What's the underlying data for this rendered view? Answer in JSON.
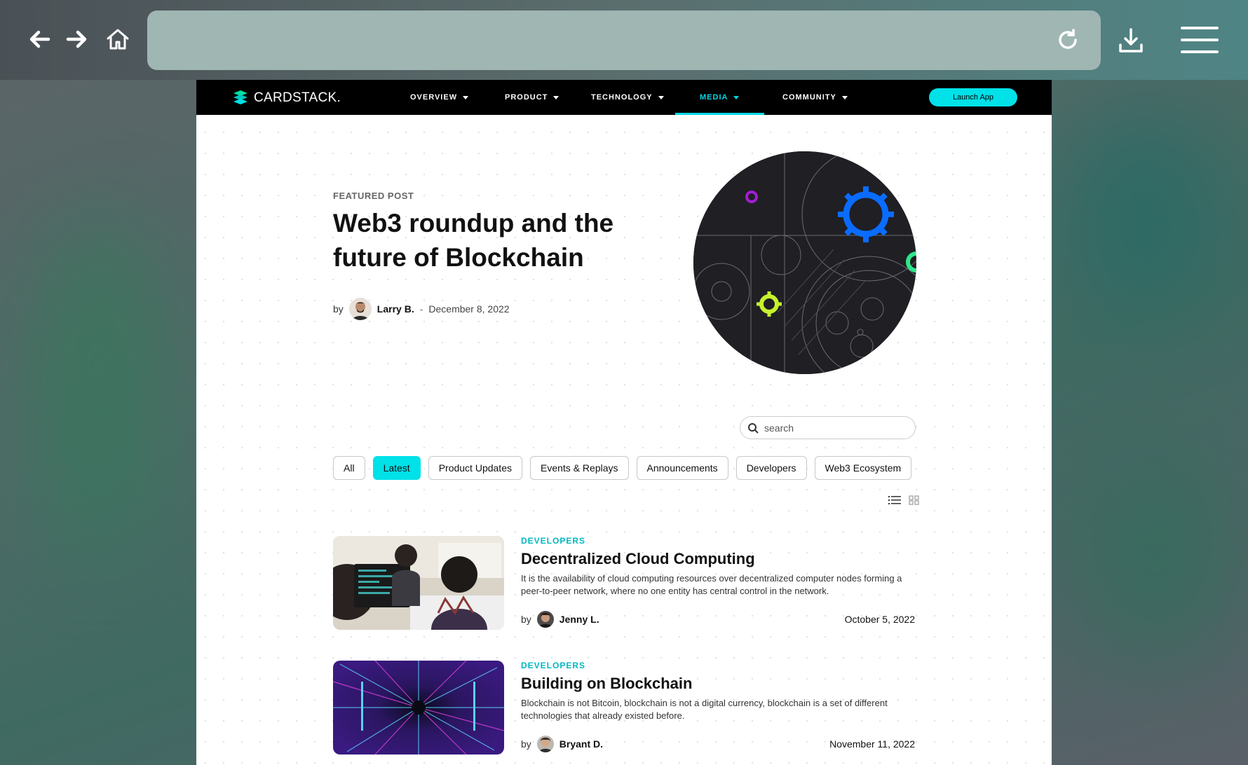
{
  "browser": {
    "address": "",
    "icons": [
      "back-arrow-icon",
      "forward-arrow-icon",
      "home-icon",
      "reload-icon",
      "download-icon",
      "hamburger-menu-icon"
    ]
  },
  "site": {
    "logo_text": "CARDSTACK.",
    "nav": [
      {
        "label": "OVERVIEW"
      },
      {
        "label": "PRODUCT"
      },
      {
        "label": "TECHNOLOGY"
      },
      {
        "label": "MEDIA"
      },
      {
        "label": "COMMUNITY"
      }
    ],
    "active_nav": "MEDIA",
    "launch_label": "Launch App",
    "accent_color": "#00e1e8"
  },
  "featured": {
    "label": "FEATURED POST",
    "title": "Web3 roundup and the future of Blockchain",
    "by": "by",
    "author": "Larry B.",
    "separator": "-",
    "date": "December 8, 2022"
  },
  "search": {
    "placeholder": "search"
  },
  "filters": [
    {
      "label": "All"
    },
    {
      "label": "Latest"
    },
    {
      "label": "Product Updates"
    },
    {
      "label": "Events & Replays"
    },
    {
      "label": "Announcements"
    },
    {
      "label": "Developers"
    },
    {
      "label": "Web3 Ecosystem"
    }
  ],
  "active_filter": "Latest",
  "posts": [
    {
      "category": "DEVELOPERS",
      "title": "Decentralized Cloud Computing",
      "description": "It is the availability of cloud computing resources over decentralized computer nodes forming a peer-to-peer network, where no one entity has central control in the network.",
      "by": "by",
      "author": "Jenny L.",
      "date": "October 5, 2022"
    },
    {
      "category": "DEVELOPERS",
      "title": "Building on Blockchain",
      "description": "Blockchain is not Bitcoin, blockchain is not a digital currency, blockchain is a set of different technologies that already existed before.",
      "by": "by",
      "author": "Bryant D.",
      "date": "November 11, 2022"
    }
  ]
}
